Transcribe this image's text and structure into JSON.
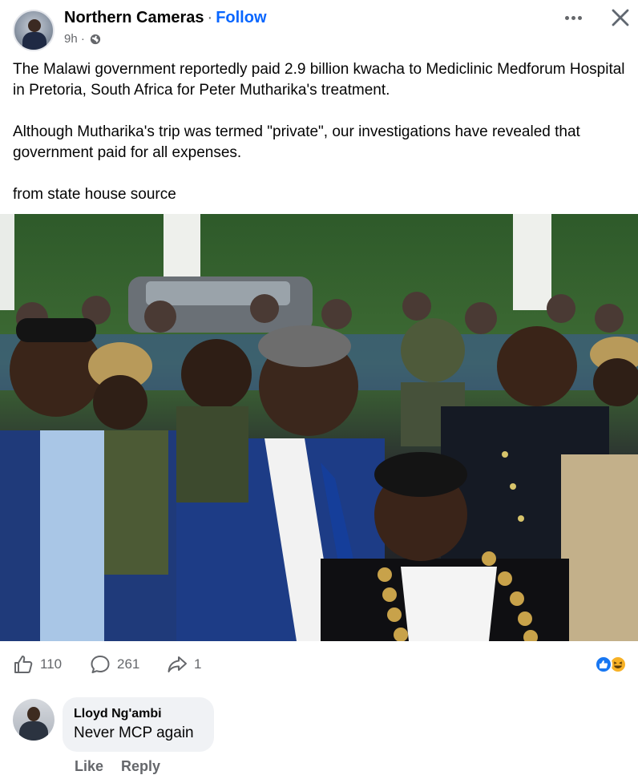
{
  "post": {
    "author": "Northern Cameras",
    "separator": "·",
    "follow_label": "Follow",
    "time": "9h ·",
    "paragraphs": [
      "The Malawi government reportedly paid 2.9 billion kwacha to Mediclinic Medforum Hospital in Pretoria, South Africa for Peter Mutharika's treatment.",
      "Although Mutharika's trip was termed \"private\", our investigations have revealed that government paid for all expenses.",
      "from state house source"
    ]
  },
  "icons": {
    "privacy": "globe-icon",
    "more": "more-icon",
    "close": "close-icon",
    "like": "thumbs-up-icon",
    "comment": "comment-icon",
    "share": "share-icon",
    "reaction_like": "like-reaction-icon",
    "reaction_haha": "haha-reaction-icon"
  },
  "stats": {
    "likes": "110",
    "comments": "261",
    "shares": "1"
  },
  "comment": {
    "author": "Lloyd Ng'ambi",
    "text": "Never MCP again",
    "like_label": "Like",
    "reply_label": "Reply"
  },
  "colors": {
    "accent": "#0866ff",
    "secondary_text": "#65676b",
    "bubble": "#f0f2f5",
    "like_blue": "#1877f2",
    "haha_yellow": "#f7b125"
  }
}
